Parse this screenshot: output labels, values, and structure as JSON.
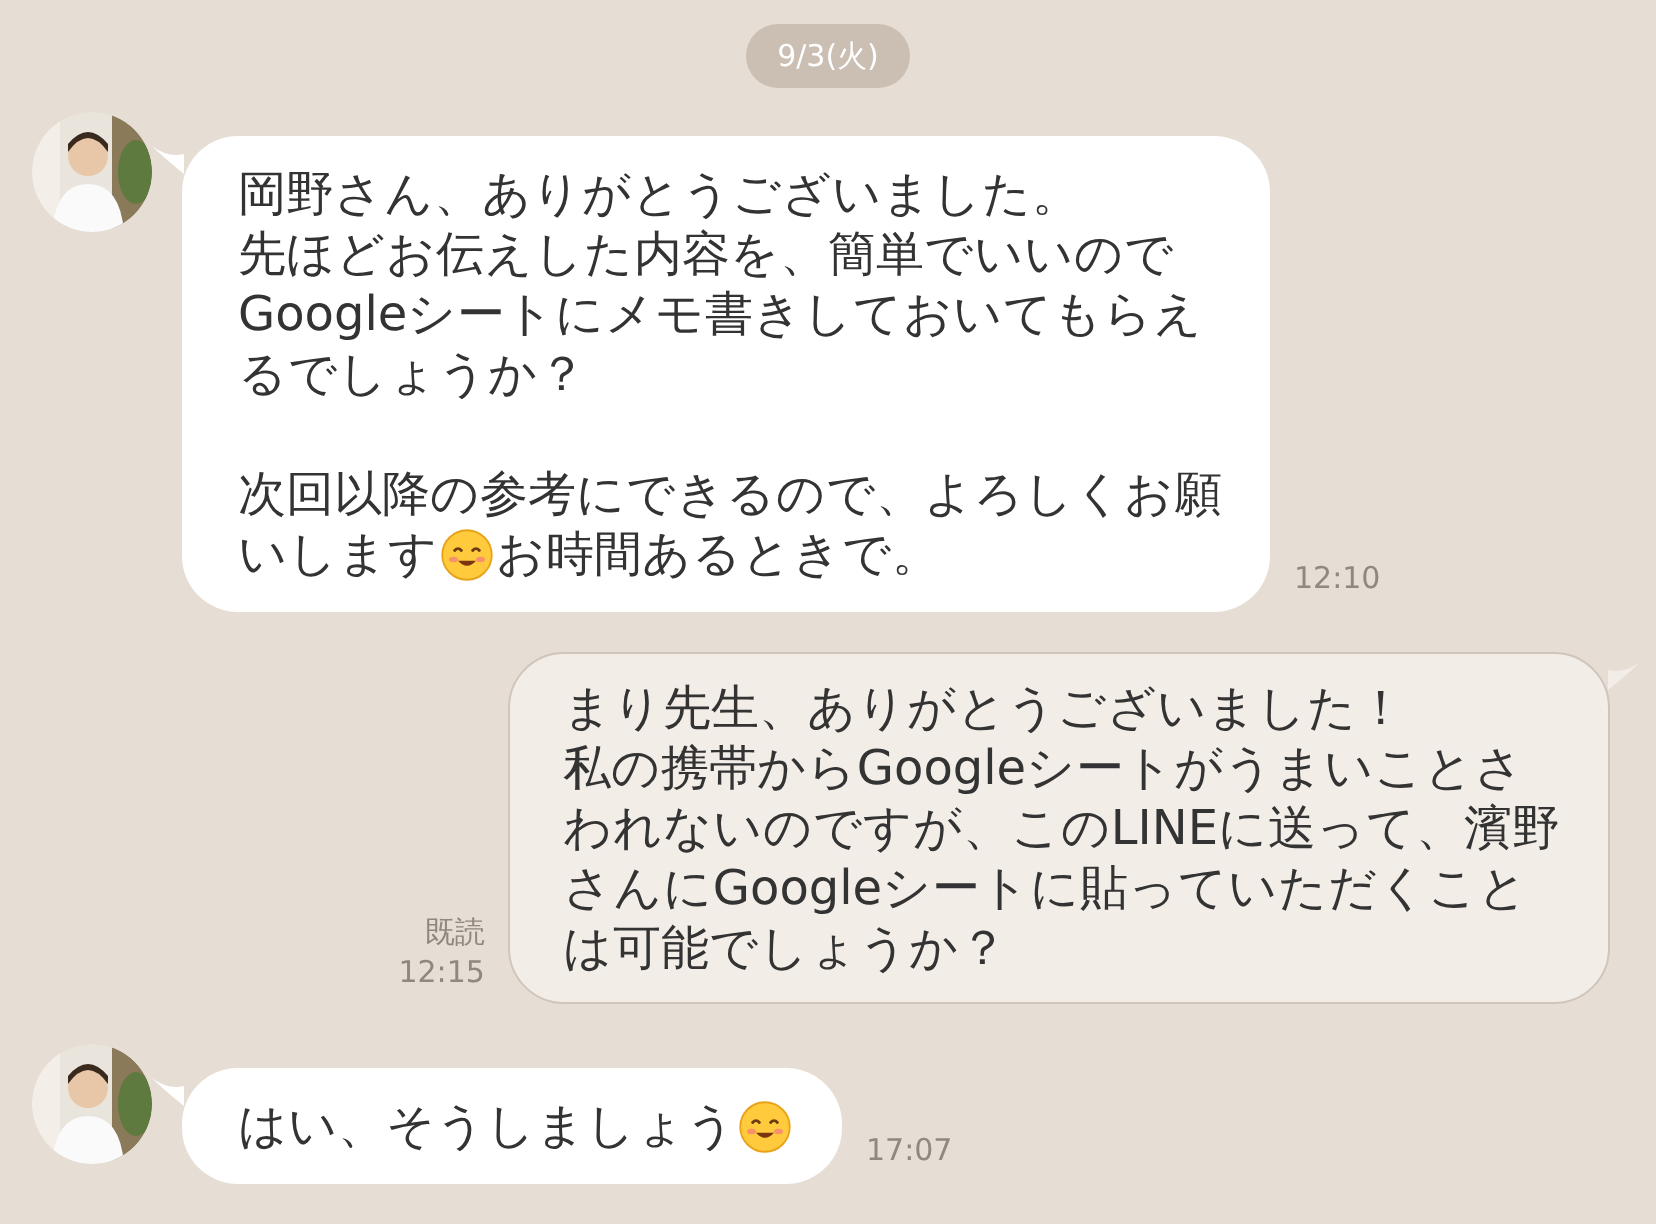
{
  "date_label": "9/3(火)",
  "messages": [
    {
      "kind": "incoming",
      "paragraphs": [
        [
          [
            {
              "kind": "text",
              "text": "岡野さん、ありがとうございました。"
            }
          ],
          [
            {
              "kind": "text",
              "text": "先ほどお伝えした内容を、簡単でいいので"
            }
          ],
          [
            {
              "kind": "text",
              "text": "Googleシートにメモ書きしておいてもらえ"
            }
          ],
          [
            {
              "kind": "text",
              "text": "るでしょうか？"
            }
          ]
        ],
        [
          [
            {
              "kind": "text",
              "text": "次回以降の参考にできるので、よろしくお願"
            }
          ],
          [
            {
              "kind": "text",
              "text": "いします"
            },
            {
              "kind": "emoji"
            },
            {
              "kind": "text",
              "text": "お時間あるときで。"
            }
          ]
        ]
      ],
      "time": "12:10"
    },
    {
      "kind": "outgoing",
      "paragraphs": [
        [
          [
            {
              "kind": "text",
              "text": "まり先生、ありがとうございました！"
            }
          ],
          [
            {
              "kind": "text",
              "text": "私の携帯からGoogleシートがうまいことさ"
            }
          ],
          [
            {
              "kind": "text",
              "text": "われないのですが、このLINEに送って、濱野"
            }
          ],
          [
            {
              "kind": "text",
              "text": "さんにGoogleシートに貼っていただくこと"
            }
          ],
          [
            {
              "kind": "text",
              "text": "は可能でしょうか？"
            }
          ]
        ]
      ],
      "read": "既読",
      "time": "12:15"
    },
    {
      "kind": "incoming",
      "paragraphs": [
        [
          [
            {
              "kind": "text",
              "text": "はい、そうしましょう"
            },
            {
              "kind": "emoji"
            }
          ]
        ]
      ],
      "time": "17:07"
    }
  ]
}
